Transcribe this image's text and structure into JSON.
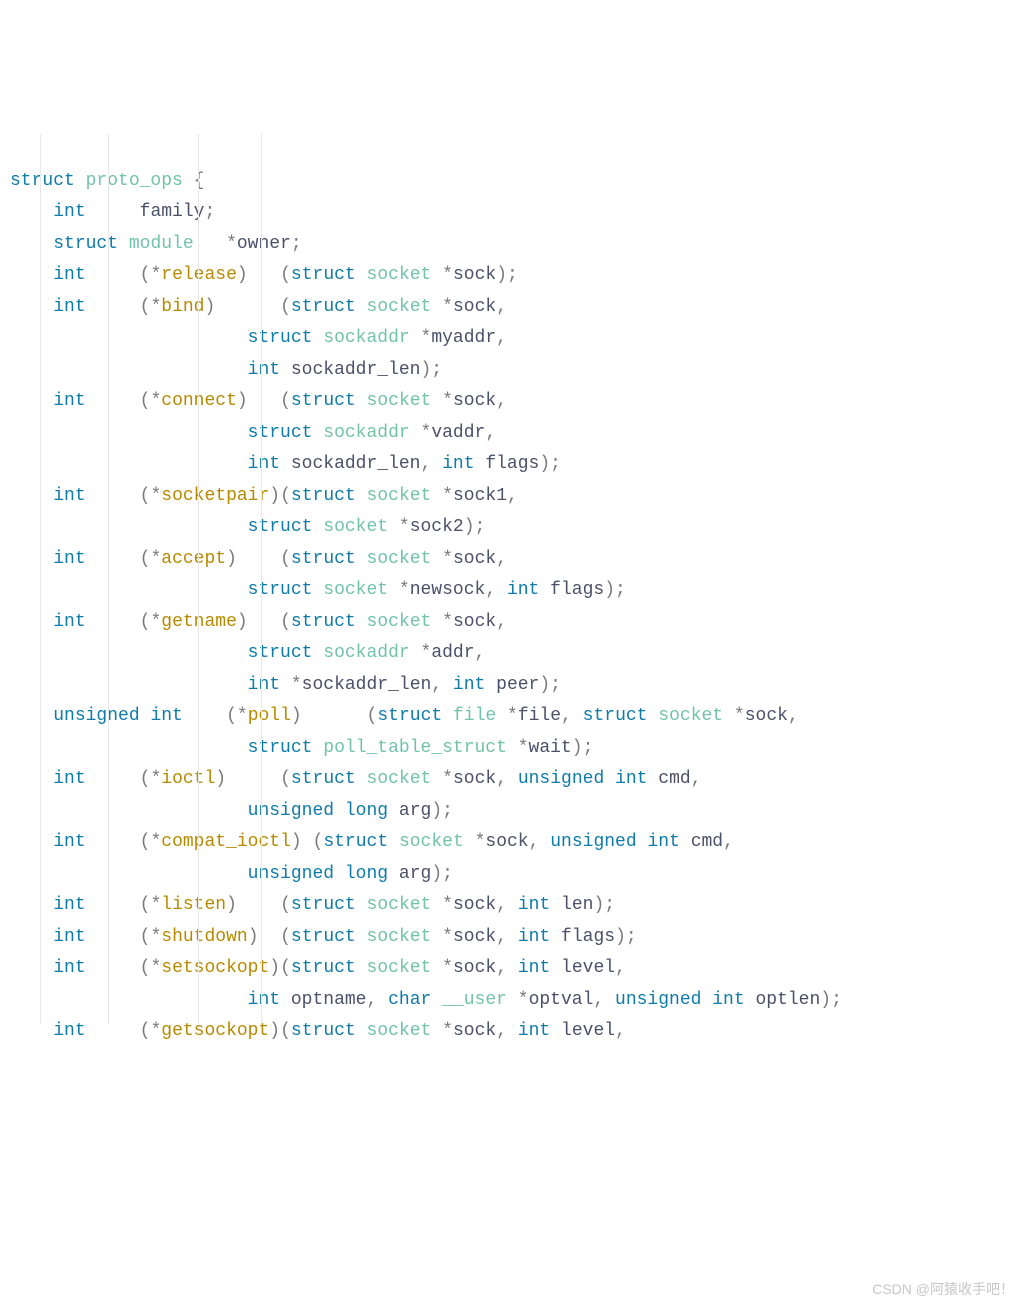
{
  "watermark": "CSDN @阿猿收手吧！",
  "kw": {
    "struct": "struct",
    "int": "int",
    "unsigned": "unsigned",
    "long": "long",
    "char": "char"
  },
  "ty": {
    "proto_ops": "proto_ops",
    "module": "module",
    "socket": "socket",
    "sockaddr": "sockaddr",
    "file": "file",
    "poll_table_struct": "poll_table_struct",
    "user": "__user"
  },
  "fn": {
    "release": "release",
    "bind": "bind",
    "connect": "connect",
    "socketpair": "socketpair",
    "accept": "accept",
    "getname": "getname",
    "poll": "poll",
    "ioctl": "ioctl",
    "compat_ioctl": "compat_ioctl",
    "listen": "listen",
    "shutdown": "shutdown",
    "setsockopt": "setsockopt",
    "getsockopt": "getsockopt"
  },
  "id": {
    "family": "family",
    "owner": "owner",
    "sock": "sock",
    "myaddr": "myaddr",
    "sockaddr_len": "sockaddr_len",
    "vaddr": "vaddr",
    "flags": "flags",
    "sock1": "sock1",
    "sock2": "sock2",
    "newsock": "newsock",
    "addr": "addr",
    "peer": "peer",
    "file": "file",
    "wait": "wait",
    "cmd": "cmd",
    "arg": "arg",
    "len": "len",
    "level": "level",
    "optname": "optname",
    "optval": "optval",
    "optlen": "optlen"
  },
  "pn": {
    "ob": "{",
    "op": "(",
    "cp": ")",
    "star": "*",
    "cm": ",",
    "sc": ";"
  }
}
